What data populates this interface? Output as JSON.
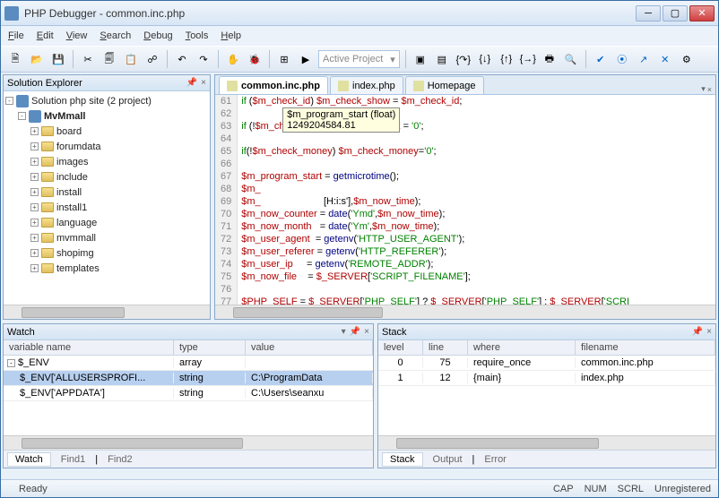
{
  "window": {
    "title": "PHP Debugger - common.inc.php"
  },
  "menu": [
    "File",
    "Edit",
    "View",
    "Search",
    "Debug",
    "Tools",
    "Help"
  ],
  "toolbar": {
    "project_selector": "Active Project"
  },
  "solution_explorer": {
    "title": "Solution Explorer",
    "root": "Solution php site (2 project)",
    "nodes": [
      "MvMmall"
    ],
    "folders": [
      "board",
      "forumdata",
      "images",
      "include",
      "install",
      "install1",
      "language",
      "mvmmall",
      "shopimg",
      "templates"
    ]
  },
  "editor": {
    "tabs": [
      {
        "label": "common.inc.php",
        "active": true
      },
      {
        "label": "index.php",
        "active": false
      },
      {
        "label": "Homepage",
        "active": false
      }
    ],
    "tooltip": {
      "line1": "$m_program_start (float)",
      "line2": "1249204584.81"
    },
    "breakpoint_line": 74,
    "current_line": 75,
    "lines": [
      {
        "n": 61,
        "html": "<span class='kw'>if</span> (<span class='var'>$m_check_id</span>) <span class='var'>$m_check_show</span> = <span class='var'>$m_check_id</span>;"
      },
      {
        "n": 62,
        "html": ""
      },
      {
        "n": 63,
        "html": "<span class='kw'>if</span> (!<span class='var'>$m_check_rank</span>) <span class='var'>$m_check_rank</span> = <span class='str'>'0'</span>;"
      },
      {
        "n": 64,
        "html": ""
      },
      {
        "n": 65,
        "html": "<span class='kw'>if</span>(!<span class='var'>$m_check_money</span>) <span class='var'>$m_check_money</span>=<span class='str'>'0'</span>;"
      },
      {
        "n": 66,
        "html": ""
      },
      {
        "n": 67,
        "html": "<span class='var'>$m_program_start</span> = <span class='fn'>getmicrotime</span>();"
      },
      {
        "n": 68,
        "html": "<span class='var'>$m_</span>"
      },
      {
        "n": 69,
        "html": "<span class='var'>$m_</span>                       [H:i:s']<span class='txt'>,</span><span class='var'>$m_now_time</span>);"
      },
      {
        "n": 70,
        "html": "<span class='var'>$m_now_counter</span> = <span class='fn'>date</span>(<span class='str'>'Ymd'</span>,<span class='var'>$m_now_time</span>);"
      },
      {
        "n": 71,
        "html": "<span class='var'>$m_now_month</span>   = <span class='fn'>date</span>(<span class='str'>'Ym'</span>,<span class='var'>$m_now_time</span>);"
      },
      {
        "n": 72,
        "html": "<span class='var'>$m_user_agent</span>  = <span class='fn'>getenv</span>(<span class='str'>'HTTP_USER_AGENT'</span>);"
      },
      {
        "n": 73,
        "html": "<span class='var'>$m_user_referer</span> = <span class='fn'>getenv</span>(<span class='str'>'HTTP_REFERER'</span>);"
      },
      {
        "n": 74,
        "html": "<span class='var'>$m_user_ip</span>     = <span class='fn'>getenv</span>(<span class='str'>'REMOTE_ADDR'</span>);"
      },
      {
        "n": 75,
        "html": "<span class='var'>$m_now_file</span>    = <span class='var'>$_SERVER</span>[<span class='str'>'SCRIPT_FILENAME'</span>];"
      },
      {
        "n": 76,
        "html": ""
      },
      {
        "n": 77,
        "html": "<span class='var'>$PHP_SELF</span> = <span class='var'>$_SERVER</span>[<span class='str'>'PHP_SELF'</span>] ? <span class='var'>$_SERVER</span>[<span class='str'>'PHP_SELF'</span>] : <span class='var'>$_SERVER</span>[<span class='str'>'SCRI</span>"
      },
      {
        "n": 78,
        "html": ""
      }
    ]
  },
  "watch": {
    "title": "Watch",
    "columns": [
      "variable name",
      "type",
      "value"
    ],
    "rows": [
      {
        "name": "$_ENV",
        "type": "array",
        "value": "",
        "sel": false,
        "expand": "-"
      },
      {
        "name": "$_ENV['ALLUSERSPROFI...",
        "type": "string",
        "value": "C:\\ProgramData",
        "sel": true,
        "expand": ""
      },
      {
        "name": "$_ENV['APPDATA']",
        "type": "string",
        "value": "C:\\Users\\seanxu",
        "sel": false,
        "expand": ""
      }
    ],
    "tabs": [
      "Watch",
      "Find1",
      "Find2"
    ]
  },
  "stack": {
    "title": "Stack",
    "columns": [
      "level",
      "line",
      "where",
      "filename"
    ],
    "rows": [
      {
        "level": "0",
        "line": "75",
        "where": "require_once",
        "filename": "common.inc.php"
      },
      {
        "level": "1",
        "line": "12",
        "where": "{main}",
        "filename": "index.php"
      }
    ],
    "tabs": [
      "Stack",
      "Output",
      "Error"
    ]
  },
  "status": {
    "left": "Ready",
    "right": [
      "CAP",
      "NUM",
      "SCRL",
      "Unregistered"
    ]
  }
}
